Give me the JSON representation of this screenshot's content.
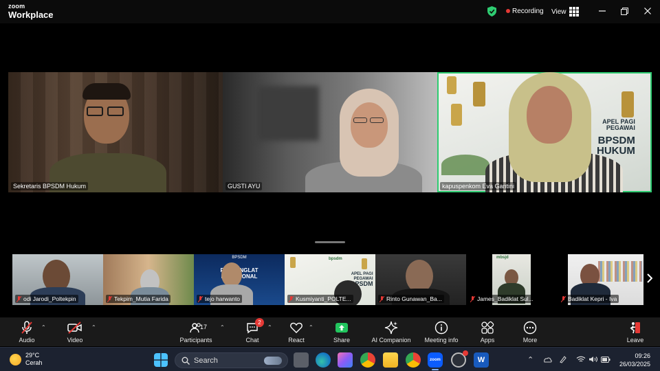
{
  "app": {
    "logo_line1": "zoom",
    "logo_line2": "Workplace"
  },
  "header": {
    "recording_label": "Recording",
    "view_label": "View"
  },
  "main_tiles": [
    {
      "name": "Sekretaris BPSDM Hukum"
    },
    {
      "name": "GUSTI AYU"
    },
    {
      "name": "kapuspenkom Eva Gantini",
      "active": true,
      "banner_line1": "APEL PAGI",
      "banner_line2": "PEGAWAI",
      "banner_line3": "BPSDM",
      "banner_line4": "HUKUM"
    }
  ],
  "thumbnails": [
    {
      "name": "odi Jarodi_Poltekpin"
    },
    {
      "name": "Tekpim_Mutia Farida"
    },
    {
      "name": "tejo harwanto",
      "banner_line1": "PUSBANGLAT",
      "banner_line2": "FUNGSIONAL",
      "banner_top": "BPSDM"
    },
    {
      "name": "Kusmiyanti_POLTE...",
      "banner_line1": "APEL PAGI",
      "banner_line2": "PEGAWAI",
      "banner_line3": "BPSDM",
      "logo_text": "bpsdm"
    },
    {
      "name": "Rinto Gunawan_Ba..."
    },
    {
      "name": "James_Badiklat Sul...",
      "logo_text": "mbsjd"
    },
    {
      "name": "Badiklat Kepri - Iva"
    }
  ],
  "toolbar": {
    "audio": "Audio",
    "video": "Video",
    "participants": "Participants",
    "participants_count": "17",
    "chat": "Chat",
    "chat_badge": "2",
    "react": "React",
    "share": "Share",
    "ai_companion": "AI Companion",
    "meeting_info": "Meeting info",
    "apps": "Apps",
    "more": "More",
    "leave": "Leave"
  },
  "taskbar": {
    "temperature": "29°C",
    "weather": "Cerah",
    "search_label": "Search",
    "time": "09:26",
    "date": "26/03/2025"
  },
  "colors": {
    "accent_green": "#2ecc71",
    "recording_red": "#e53935",
    "share_green": "#22c55e",
    "toolbar_bg": "#1a1a1a"
  }
}
